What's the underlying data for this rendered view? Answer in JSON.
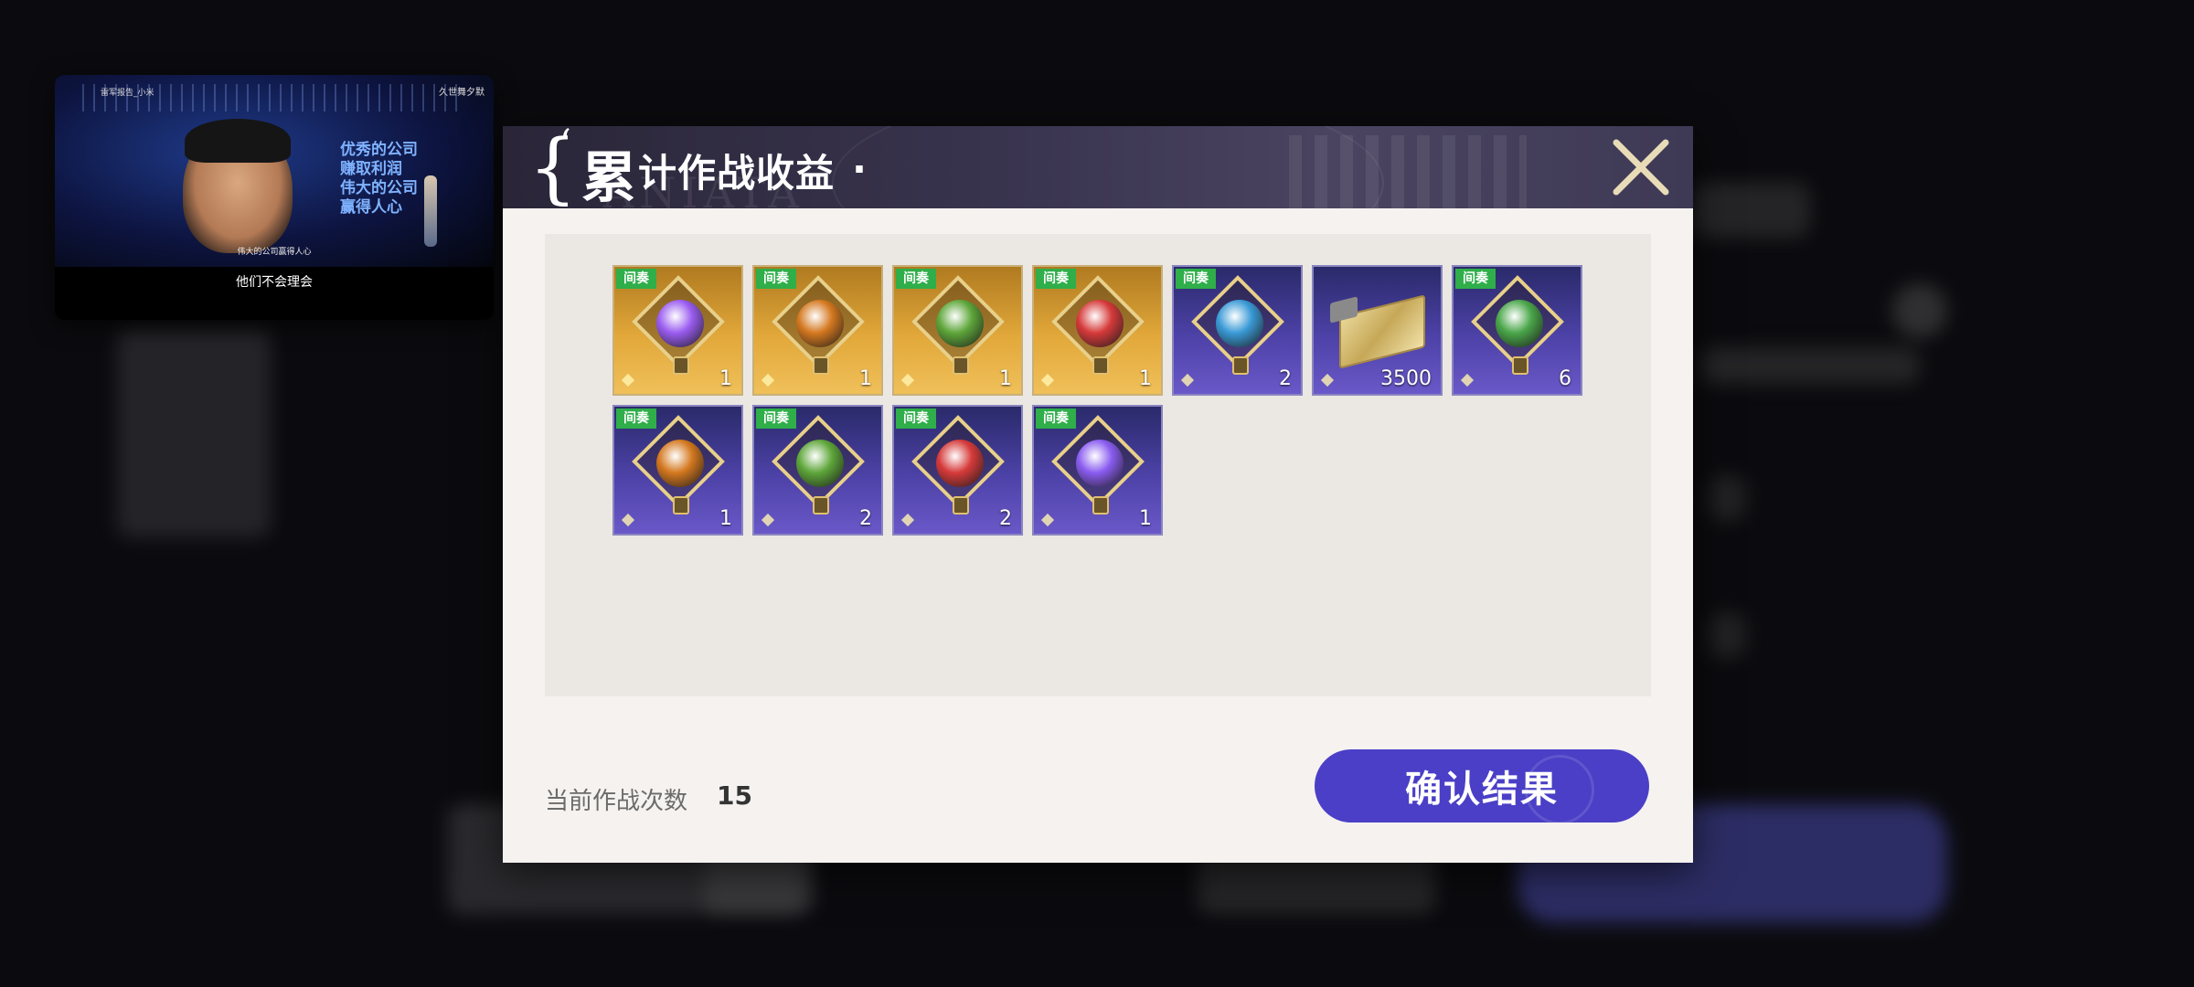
{
  "video": {
    "tag_left": "雷军报告_小米",
    "tag_right": "久世舞夕默",
    "slogan": [
      "优秀的公司",
      "赚取利润",
      "伟大的公司",
      "赢得人心"
    ],
    "subtitle_small": "伟大的公司赢得人心",
    "caption": "他们不会理会"
  },
  "modal": {
    "title_first": "累",
    "title_rest": "计作战收益",
    "title_dot": ".",
    "header_watermark": "ANIATA",
    "close_icon": "close-x-icon",
    "items": [
      {
        "badge": "间奏",
        "count": "1",
        "bg": "gold",
        "gem": "#9a5cf0",
        "icon": "purple-gem-icon"
      },
      {
        "badge": "间奏",
        "count": "1",
        "bg": "gold",
        "gem": "#d4781f",
        "icon": "orange-gem-icon"
      },
      {
        "badge": "间奏",
        "count": "1",
        "bg": "gold",
        "gem": "#5ea63a",
        "icon": "green-gem-icon"
      },
      {
        "badge": "间奏",
        "count": "1",
        "bg": "gold",
        "gem": "#d63a3a",
        "icon": "red-gem-icon"
      },
      {
        "badge": "间奏",
        "count": "2",
        "bg": "purple",
        "gem": "#3a9ad6",
        "icon": "blue-gem-icon"
      },
      {
        "badge": "",
        "count": "3500",
        "bg": "purple",
        "gem": "",
        "icon": "gold-ticket-icon"
      },
      {
        "badge": "间奏",
        "count": "6",
        "bg": "purple",
        "gem": "#4aa64a",
        "icon": "green-shield-gem-icon"
      },
      {
        "badge": "间奏",
        "count": "1",
        "bg": "purple",
        "gem": "#d4781f",
        "icon": "orange-gem-icon"
      },
      {
        "badge": "间奏",
        "count": "2",
        "bg": "purple",
        "gem": "#5ea63a",
        "icon": "green-gem-icon"
      },
      {
        "badge": "间奏",
        "count": "2",
        "bg": "purple",
        "gem": "#d63a3a",
        "icon": "red-gem-icon"
      },
      {
        "badge": "间奏",
        "count": "1",
        "bg": "purple",
        "gem": "#8a5cf0",
        "icon": "purple-gem-icon"
      }
    ],
    "footer": {
      "label": "当前作战次数",
      "count": "15"
    },
    "confirm_label": "确认结果"
  },
  "colors": {
    "badge_green": "#2fae4a",
    "confirm_purple": "#4a3fc6",
    "header_dark": "#2a2638"
  }
}
